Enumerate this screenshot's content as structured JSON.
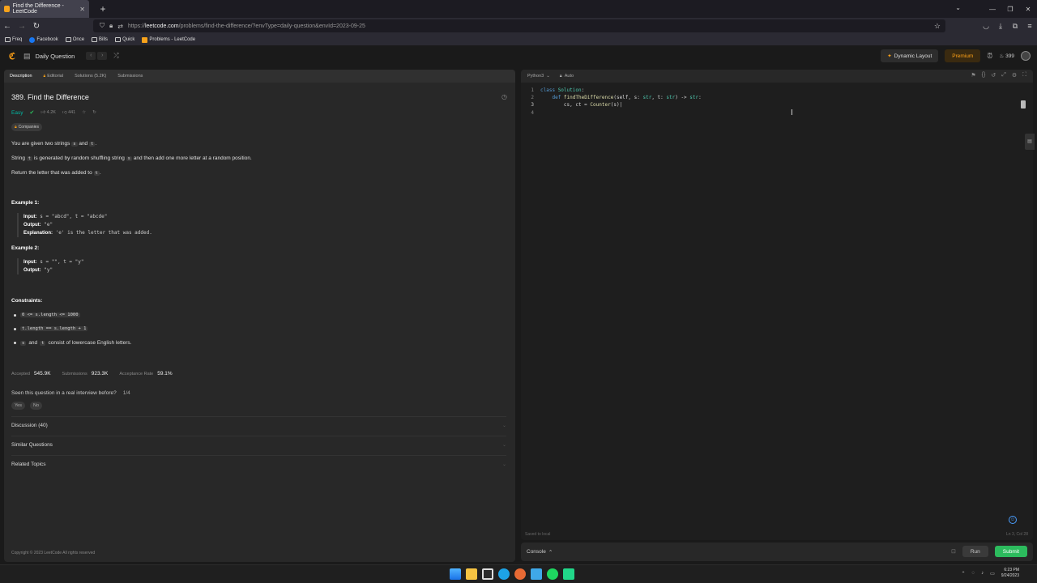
{
  "browser": {
    "tab_title": "Find the Difference - LeetCode",
    "url_host": "leetcode.com",
    "url_prefix": "https://",
    "url_path": "/problems/find-the-difference/?envType=daily-question&envId=2023-09-25",
    "bookmarks": [
      "Freq",
      "Facebook",
      "Once",
      "Bills",
      "Quick",
      "Problems - LeetCode"
    ]
  },
  "header": {
    "daily_question": "Daily Question",
    "dynamic_layout": "Dynamic Layout",
    "premium": "Premium",
    "streak": "399"
  },
  "left_tabs": [
    "Description",
    "Editorial",
    "Solutions (5.2K)",
    "Submissions"
  ],
  "problem": {
    "title": "389. Find the Difference",
    "difficulty": "Easy",
    "likes": "4.2K",
    "dislikes": "441",
    "companies": "Companies",
    "p1_a": "You are given two strings",
    "p1_s": "s",
    "p1_and": "and",
    "p1_t": "t",
    "p1_end": ".",
    "p2_a": "String",
    "p2_t": "t",
    "p2_b": "is generated by random shuffling string",
    "p2_s": "s",
    "p2_c": "and then add one more letter at a random position.",
    "p3_a": "Return the letter that was added to",
    "p3_t": "t",
    "p3_end": ".",
    "ex1_title": "Example 1:",
    "ex1_input_label": "Input:",
    "ex1_input": "s = \"abcd\", t = \"abcde\"",
    "ex1_output_label": "Output:",
    "ex1_output": "\"e\"",
    "ex1_expl_label": "Explanation:",
    "ex1_expl": "'e' is the letter that was added.",
    "ex2_title": "Example 2:",
    "ex2_input_label": "Input:",
    "ex2_input": "s = \"\", t = \"y\"",
    "ex2_output_label": "Output:",
    "ex2_output": "\"y\"",
    "constraints_title": "Constraints:",
    "c1": "0 <= s.length <= 1000",
    "c2": "t.length == s.length + 1",
    "c3_s": "s",
    "c3_and": "and",
    "c3_t": "t",
    "c3_rest": "consist of lowercase English letters."
  },
  "stats": {
    "accepted_label": "Accepted",
    "accepted": "545.9K",
    "submissions_label": "Submissions",
    "submissions": "923.3K",
    "rate_label": "Acceptance Rate",
    "rate": "59.1%"
  },
  "interview": {
    "question": "Seen this question in a real interview before?",
    "count": "1/4",
    "yes": "Yes",
    "no": "No"
  },
  "accordions": [
    "Discussion (40)",
    "Similar Questions",
    "Related Topics"
  ],
  "copyright": "Copyright © 2023 LeetCode All rights reserved",
  "editor": {
    "language": "Python3",
    "mode": "Auto",
    "lines": [
      {
        "n": "1",
        "text": "class Solution:"
      },
      {
        "n": "2",
        "text": "    def findTheDifference(self, s: str, t: str) -> str:"
      },
      {
        "n": "3",
        "text": "        cs, ct = Counter(s)"
      },
      {
        "n": "4",
        "text": ""
      }
    ],
    "saved": "Saved to local",
    "position": "Ln 3, Col 28"
  },
  "console_bar": {
    "console": "Console",
    "run": "Run",
    "submit": "Submit"
  },
  "taskbar": {
    "time": "6:23 PM",
    "date": "9/24/2023"
  },
  "colors": {
    "accent": "#ffa116",
    "easy": "#00b8a3",
    "submit": "#2cbb5d"
  }
}
